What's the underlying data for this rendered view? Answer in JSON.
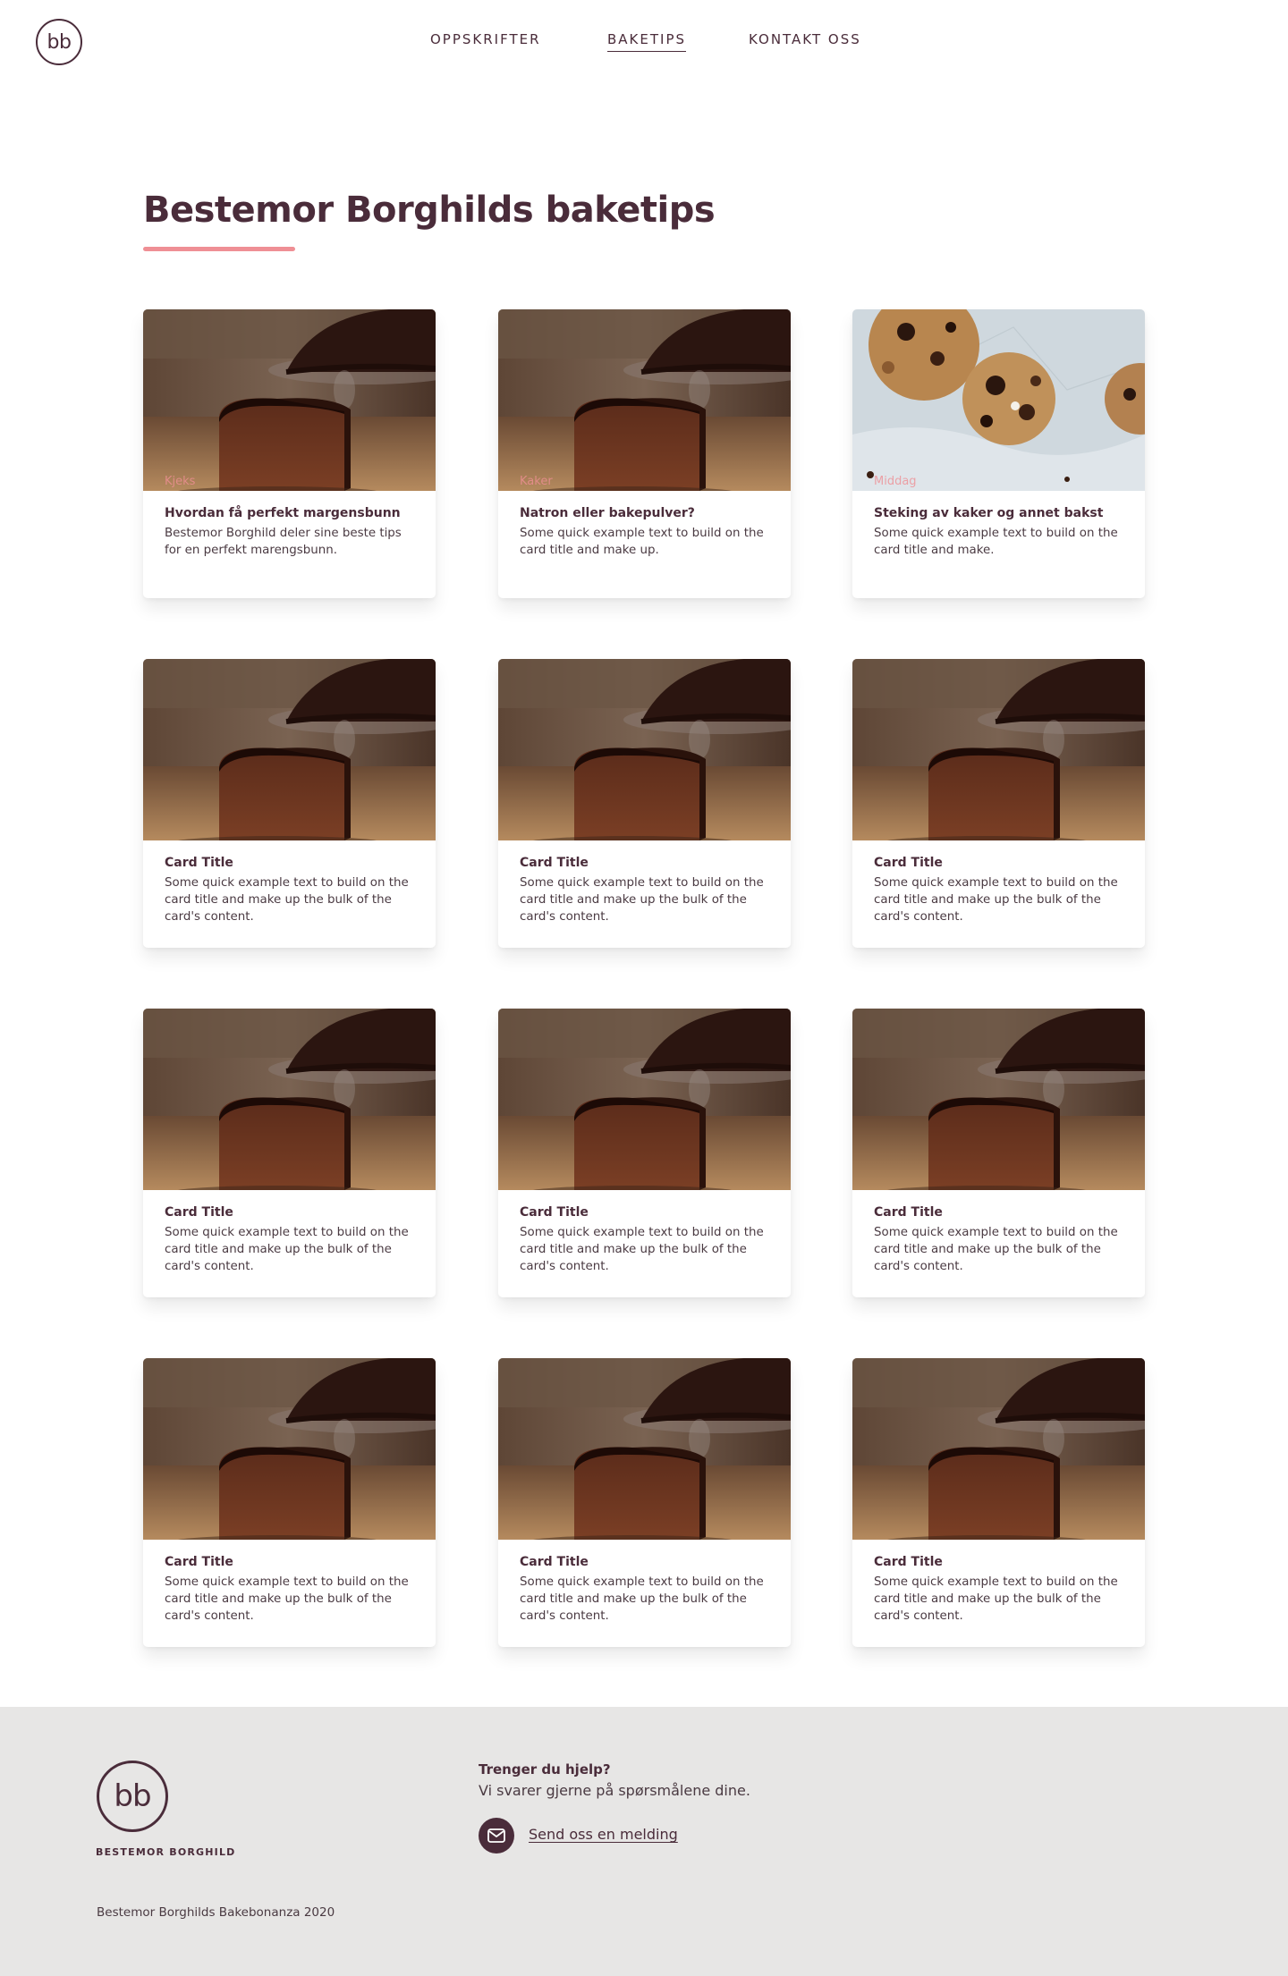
{
  "header": {
    "logo_text": "bb",
    "nav": [
      {
        "label": "OPPSKRIFTER"
      },
      {
        "label": "BAKETIPS"
      },
      {
        "label": "KONTAKT OSS"
      }
    ]
  },
  "main": {
    "title": "Bestemor Borghilds baketips",
    "cards": [
      {
        "image": "chocolate-cake",
        "tag": "Kjeks",
        "title": "Hvordan få perfekt margensbunn",
        "text": "Bestemor Borghild deler sine beste tips for en perfekt marengsbunn."
      },
      {
        "image": "chocolate-cake",
        "tag": "Kaker",
        "title": "Natron eller bakepulver?",
        "text": "Some quick example text to build on the card title and make up."
      },
      {
        "image": "cookies",
        "tag": "Middag",
        "title": "Steking av kaker og annet bakst",
        "text": "Some quick example text to build on the card title and make."
      },
      {
        "image": "chocolate-cake",
        "tag": "",
        "title": "Card Title",
        "text": "Some quick example text to build on the card title and make up the bulk of the card's content."
      },
      {
        "image": "chocolate-cake",
        "tag": "",
        "title": "Card Title",
        "text": "Some quick example text to build on the card title and make up the bulk of the card's content."
      },
      {
        "image": "chocolate-cake",
        "tag": "",
        "title": "Card Title",
        "text": "Some quick example text to build on the card title and make up the bulk of the card's content."
      },
      {
        "image": "chocolate-cake",
        "tag": "",
        "title": "Card Title",
        "text": "Some quick example text to build on the card title and make up the bulk of the card's content."
      },
      {
        "image": "chocolate-cake",
        "tag": "",
        "title": "Card Title",
        "text": "Some quick example text to build on the card title and make up the bulk of the card's content."
      },
      {
        "image": "chocolate-cake",
        "tag": "",
        "title": "Card Title",
        "text": "Some quick example text to build on the card title and make up the bulk of the card's content."
      },
      {
        "image": "chocolate-cake",
        "tag": "",
        "title": "Card Title",
        "text": "Some quick example text to build on the card title and make up the bulk of the card's content."
      },
      {
        "image": "chocolate-cake",
        "tag": "",
        "title": "Card Title",
        "text": "Some quick example text to build on the card title and make up the bulk of the card's content."
      },
      {
        "image": "chocolate-cake",
        "tag": "",
        "title": "Card Title",
        "text": "Some quick example text to build on the card title and make up the bulk of the card's content."
      }
    ]
  },
  "footer": {
    "logo_text": "bb",
    "brand": "BESTEMOR BORGHILD",
    "help_heading": "Trenger du hjelp?",
    "help_text": "Vi svarer gjerne på spørsmålene dine.",
    "mail_icon": "envelope-icon",
    "mail_link": "Send oss en melding",
    "copyright": "Bestemor Borghilds Bakebonanza 2020"
  },
  "colors": {
    "primary": "#4a2c3a",
    "accent": "#ef8f95",
    "footer_bg": "#e7e6e5"
  }
}
